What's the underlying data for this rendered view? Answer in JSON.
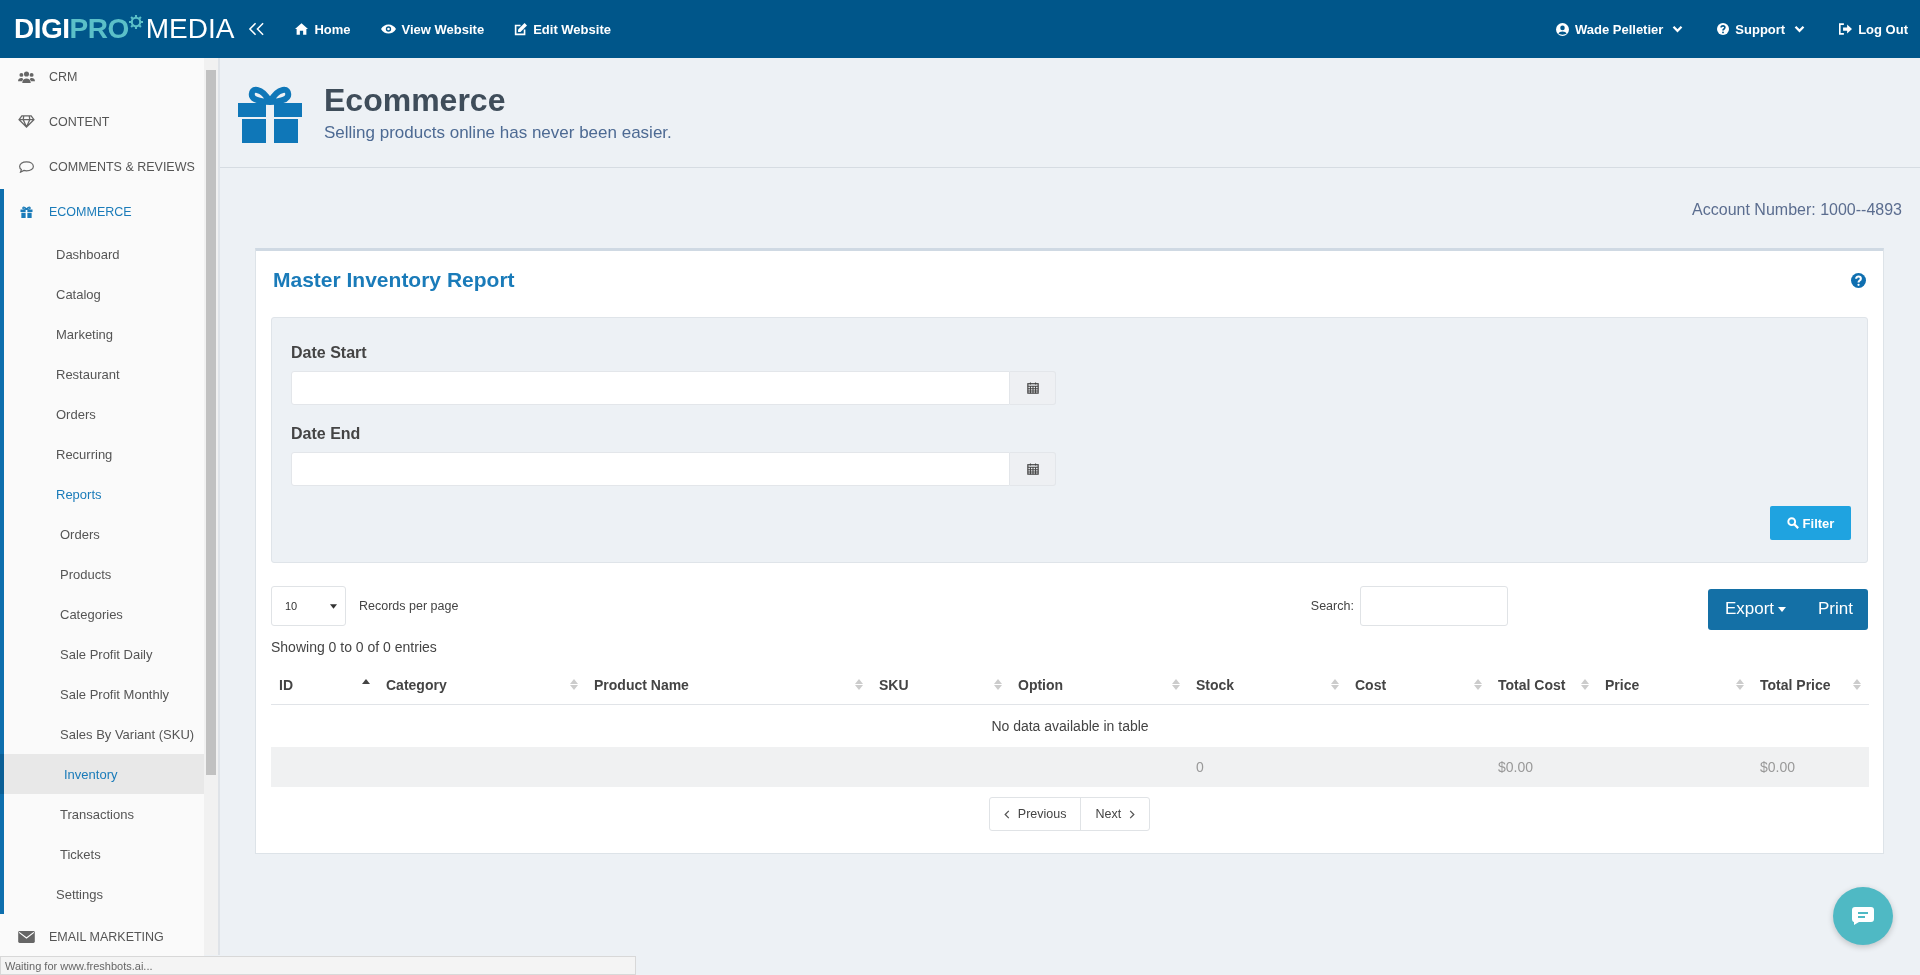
{
  "top_bar": {
    "logo": [
      "DIGI",
      "PRO",
      "MEDIA"
    ],
    "nav": [
      {
        "label": "Home"
      },
      {
        "label": "View Website"
      },
      {
        "label": "Edit Website"
      }
    ],
    "user_menu": [
      {
        "label": "Wade Pelletier",
        "dropdown": true
      },
      {
        "label": "Support",
        "dropdown": true
      },
      {
        "label": "Log Out",
        "dropdown": false
      }
    ]
  },
  "sidebar": {
    "items": [
      {
        "label": "CRM",
        "expanded": false
      },
      {
        "label": "CONTENT",
        "expanded": false
      },
      {
        "label": "COMMENTS & REVIEWS",
        "expanded": false
      },
      {
        "label": "ECOMMERCE",
        "expanded": true,
        "children": [
          {
            "label": "Dashboard",
            "selected": false
          },
          {
            "label": "Catalog",
            "selected": false
          },
          {
            "label": "Marketing",
            "selected": false
          },
          {
            "label": "Restaurant",
            "selected": false
          },
          {
            "label": "Orders",
            "selected": false
          },
          {
            "label": "Recurring",
            "selected": false
          },
          {
            "label": "Reports",
            "expanded": true,
            "children": [
              {
                "label": "Orders",
                "selected": false
              },
              {
                "label": "Products",
                "selected": false
              },
              {
                "label": "Categories",
                "selected": false
              },
              {
                "label": "Sale Profit Daily",
                "selected": false
              },
              {
                "label": "Sale Profit Monthly",
                "selected": false
              },
              {
                "label": "Sales By Variant (SKU)",
                "selected": false
              },
              {
                "label": "Inventory",
                "selected": true
              },
              {
                "label": "Transactions",
                "selected": false
              },
              {
                "label": "Tickets",
                "selected": false
              }
            ]
          },
          {
            "label": "Settings",
            "selected": false
          }
        ]
      },
      {
        "label": "EMAIL MARKETING",
        "expanded": false
      }
    ]
  },
  "page_header": {
    "title": "Ecommerce",
    "subtitle": "Selling products online has never been easier."
  },
  "account_number": "Account Number: 1000--4893",
  "report": {
    "title": "Master Inventory Report",
    "filters": [
      {
        "label": "Date Start"
      },
      {
        "label": "Date End"
      }
    ],
    "filter_button": "Filter",
    "page_size": "10",
    "page_size_label": "Records per page",
    "search_label": "Search:",
    "export_button": "Export",
    "print_button": "Print",
    "info": "Showing 0 to 0 of 0 entries",
    "columns": [
      {
        "label": "ID",
        "sorted": true
      },
      {
        "label": "Category",
        "sorted": false
      },
      {
        "label": "Product Name",
        "sorted": false
      },
      {
        "label": "SKU",
        "sorted": false
      },
      {
        "label": "Option",
        "sorted": false
      },
      {
        "label": "Stock",
        "sorted": false,
        "footer": "0"
      },
      {
        "label": "Cost",
        "sorted": false
      },
      {
        "label": "Total Cost",
        "sorted": false,
        "footer": "$0.00"
      },
      {
        "label": "Price",
        "sorted": false
      },
      {
        "label": "Total Price",
        "sorted": false,
        "footer": "$0.00"
      }
    ],
    "empty_message": "No data available in table",
    "pagination": [
      "Previous",
      "Next"
    ]
  },
  "status_text": "Waiting for www.freshbots.ai..."
}
